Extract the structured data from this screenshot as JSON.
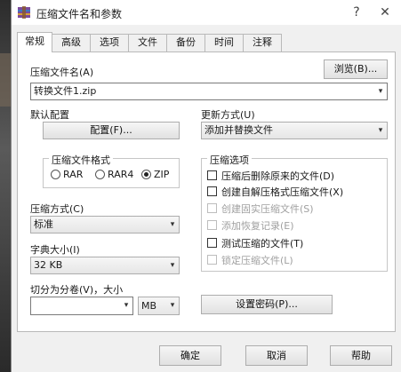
{
  "window": {
    "title": "压缩文件名和参数",
    "help_glyph": "?",
    "close_glyph": "✕"
  },
  "tabs": [
    {
      "label": "常规"
    },
    {
      "label": "高级"
    },
    {
      "label": "选项"
    },
    {
      "label": "文件"
    },
    {
      "label": "备份"
    },
    {
      "label": "时间"
    },
    {
      "label": "注释"
    }
  ],
  "archive_name": {
    "label": "压缩文件名(A)",
    "value": "转换文件1.zip",
    "browse": "浏览(B)..."
  },
  "default_profile": {
    "label": "默认配置",
    "button": "配置(F)..."
  },
  "update_mode": {
    "label": "更新方式(U)",
    "value": "添加并替换文件"
  },
  "format": {
    "title": "压缩文件格式",
    "options": [
      "RAR",
      "RAR4",
      "ZIP"
    ],
    "selected": "ZIP"
  },
  "method": {
    "label": "压缩方式(C)",
    "value": "标准"
  },
  "dictionary": {
    "label": "字典大小(I)",
    "value": "32 KB"
  },
  "split": {
    "label": "切分为分卷(V)，大小",
    "value": "",
    "unit": "MB"
  },
  "options": {
    "title": "压缩选项",
    "items": [
      {
        "label": "压缩后删除原来的文件(D)",
        "checked": false,
        "enabled": true
      },
      {
        "label": "创建自解压格式压缩文件(X)",
        "checked": false,
        "enabled": true
      },
      {
        "label": "创建固实压缩文件(S)",
        "checked": false,
        "enabled": false
      },
      {
        "label": "添加恢复记录(E)",
        "checked": false,
        "enabled": false
      },
      {
        "label": "测试压缩的文件(T)",
        "checked": false,
        "enabled": true
      },
      {
        "label": "锁定压缩文件(L)",
        "checked": false,
        "enabled": false
      }
    ]
  },
  "password_button": "设置密码(P)...",
  "footer": {
    "ok": "确定",
    "cancel": "取消",
    "help": "帮助"
  },
  "icons": {
    "dropdown": "▾",
    "app": "winrar-archive-icon"
  }
}
